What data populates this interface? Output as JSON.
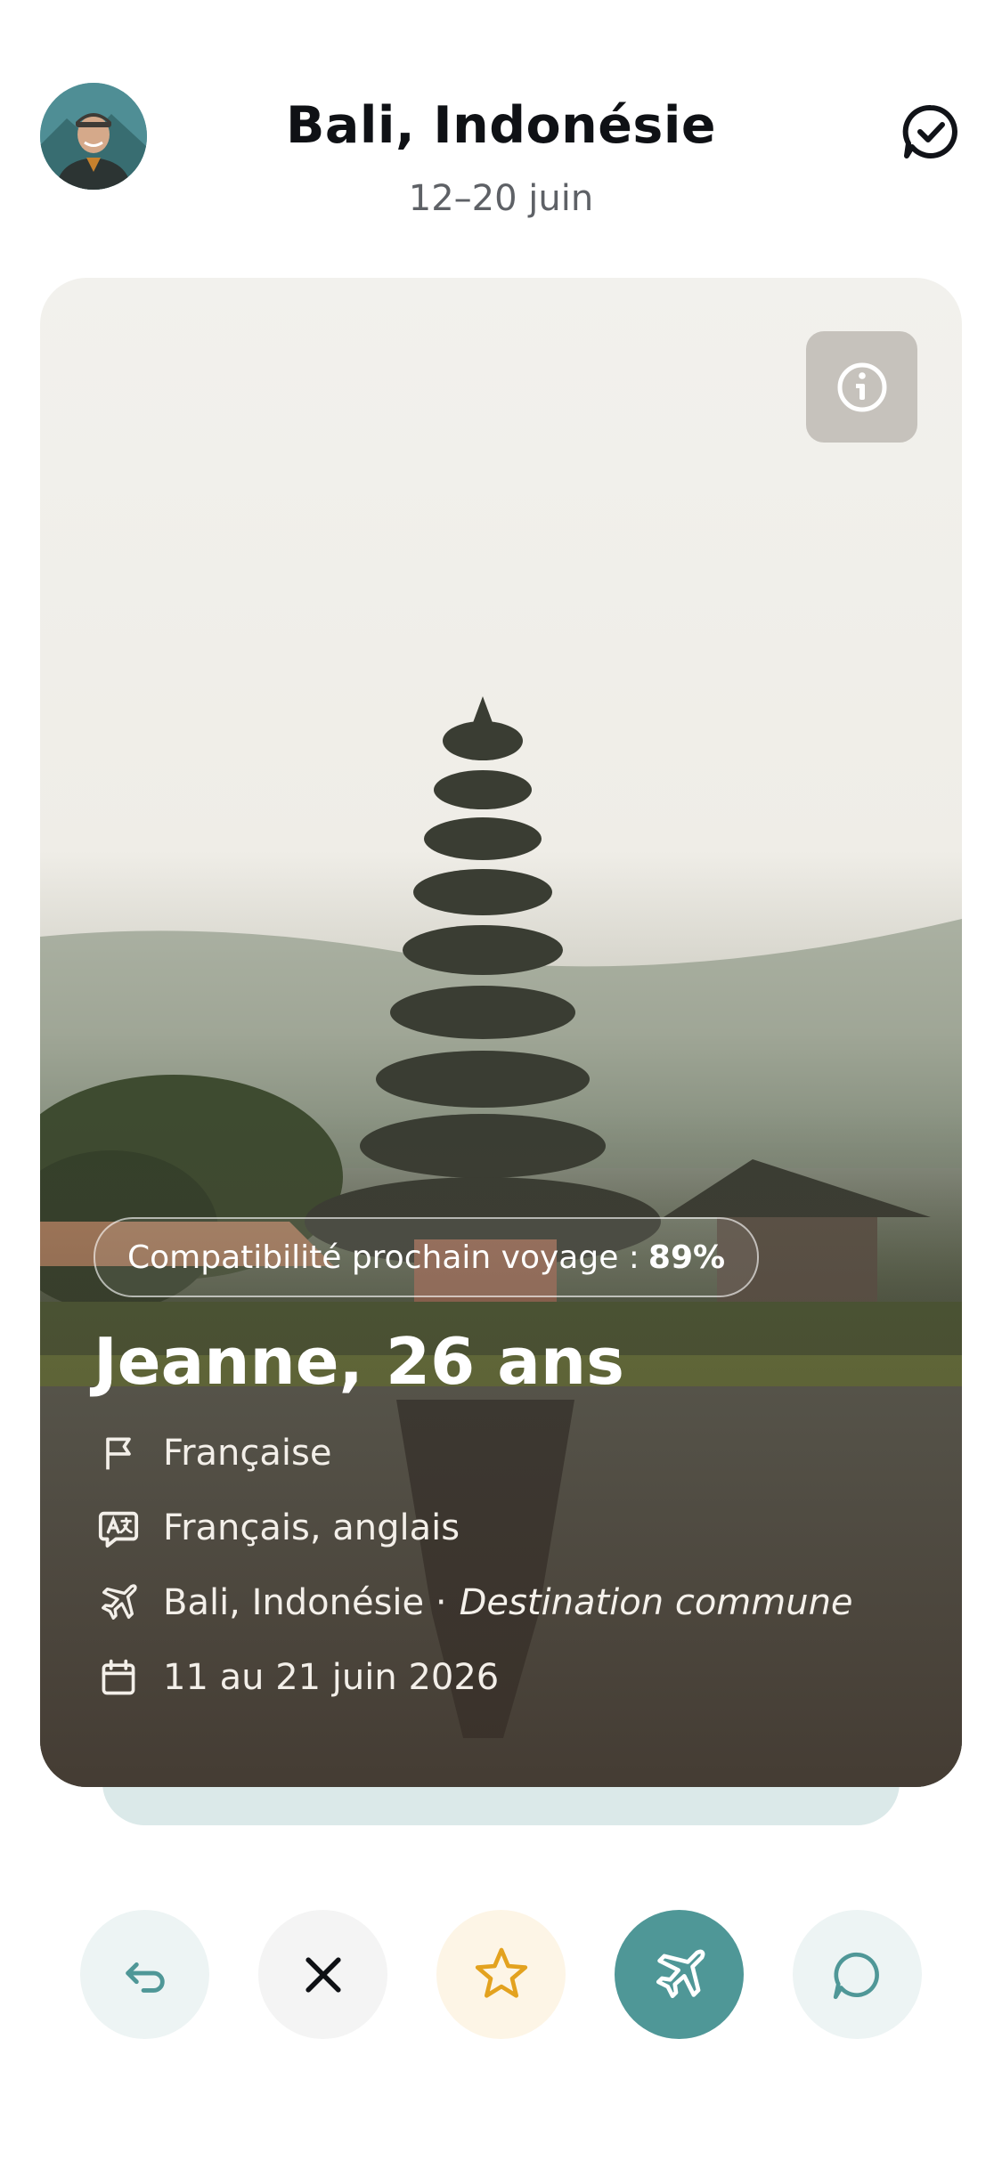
{
  "header": {
    "title": "Bali, Indonésie",
    "dates": "12–20 juin",
    "avatar_icon": "avatar",
    "chat_icon": "chat-check-icon"
  },
  "card": {
    "compatibility_label": "Compatibilité prochain voyage :",
    "compatibility_value": "89%",
    "name_age": "Jeanne, 26 ans",
    "nationality": "Française",
    "languages": "Français, anglais",
    "destination": "Bali, Indonésie ·",
    "destination_note": "Destination commune",
    "dates": "11 au 21 juin 2026",
    "info_icon": "info-icon"
  },
  "actions": [
    {
      "name": "undo-button",
      "icon": "undo-icon",
      "bg": "#edf4f4"
    },
    {
      "name": "reject-button",
      "icon": "close-icon",
      "bg": "#f4f4f4"
    },
    {
      "name": "favorite-button",
      "icon": "star-icon",
      "bg": "#fdf5e6"
    },
    {
      "name": "travel-together-button",
      "icon": "plane-icon",
      "bg": "#4f9797"
    },
    {
      "name": "message-button",
      "icon": "chat-icon",
      "bg": "#edf4f4"
    }
  ],
  "colors": {
    "accent": "#4f9797",
    "star": "#e3a21f",
    "text": "#0f1115"
  }
}
